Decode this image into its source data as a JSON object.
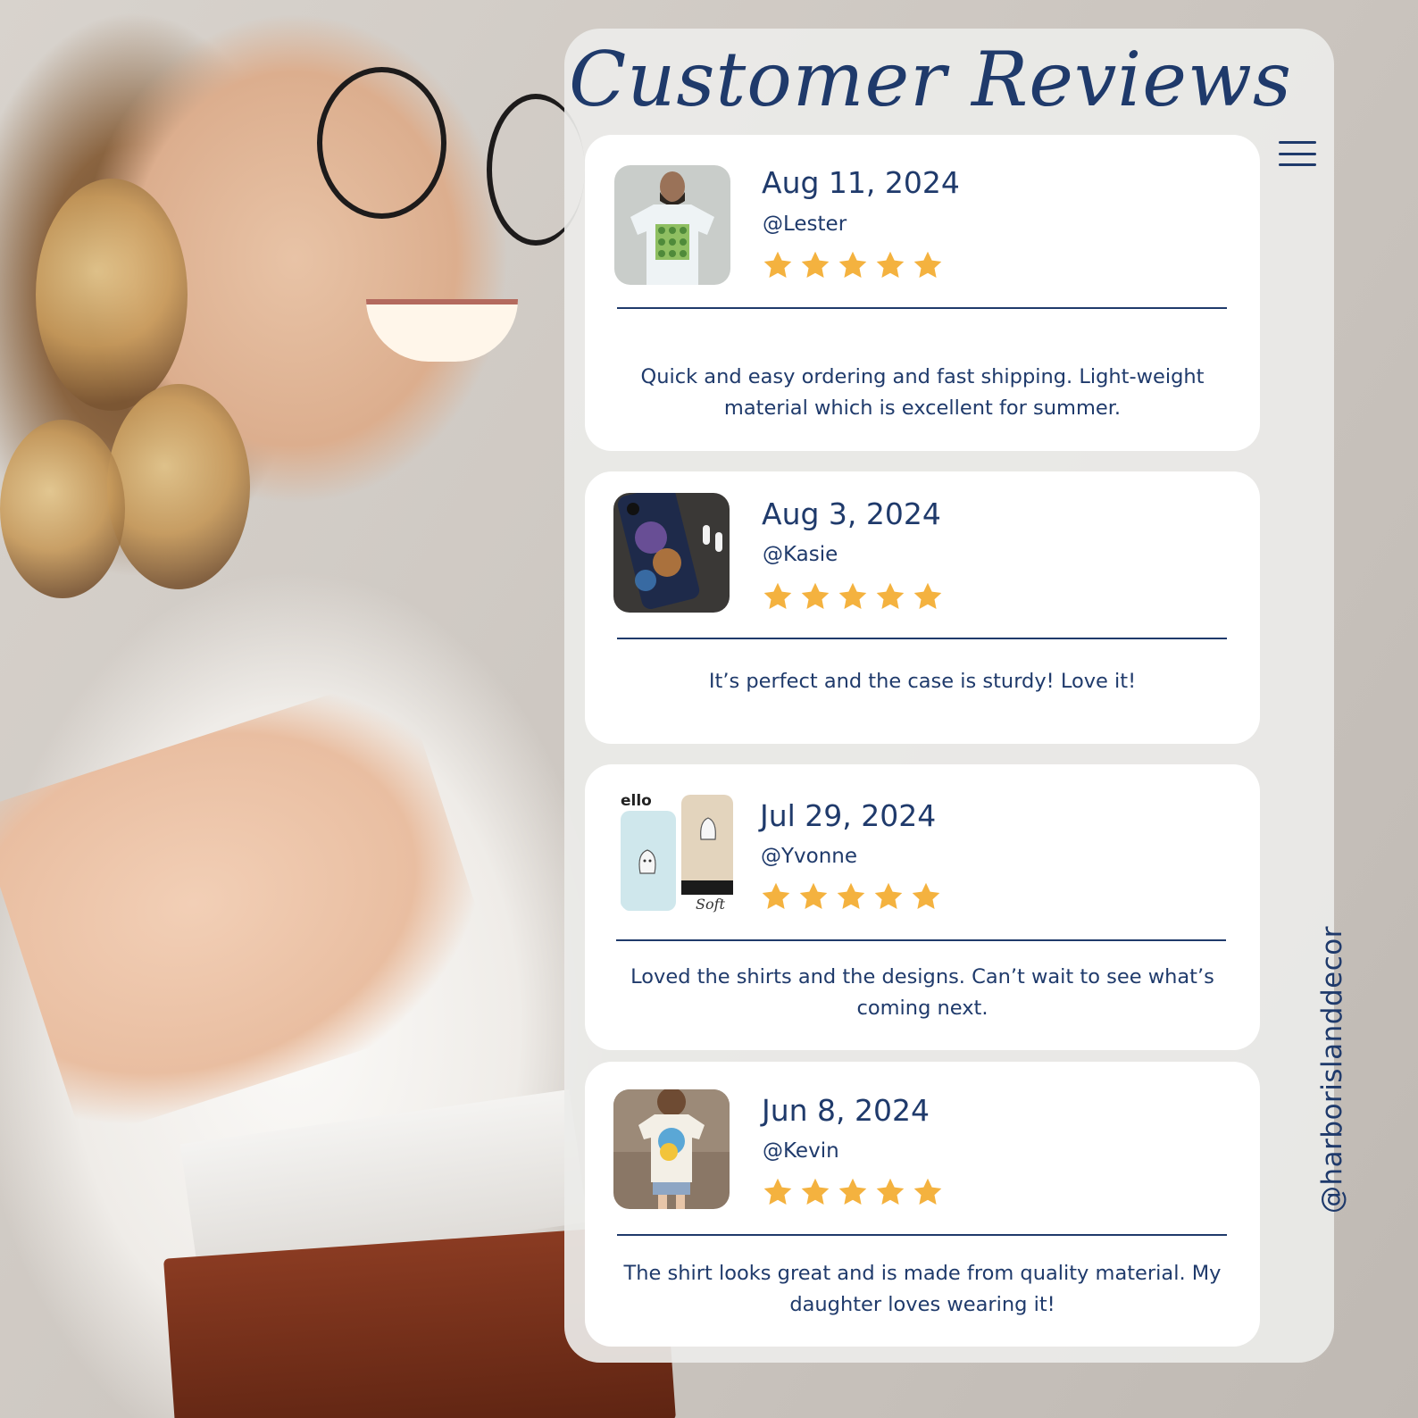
{
  "page": {
    "title": "Customer Reviews",
    "handle": "@harborislanddecor"
  },
  "colors": {
    "accent": "#1f3a6b",
    "star": "#f4b23f",
    "card": "#ffffff",
    "panel": "#ecebe9"
  },
  "icons": {
    "menu": "hamburger-menu-icon",
    "star": "star-icon"
  },
  "reviews": [
    {
      "date": "Aug 11, 2024",
      "user": "@Lester",
      "rating": 5,
      "text": "Quick and easy ordering and fast shipping. Light-weight material which is excellent for summer."
    },
    {
      "date": "Aug 3, 2024",
      "user": "@Kasie",
      "rating": 5,
      "text": "It’s perfect and the case is sturdy! Love it!"
    },
    {
      "date": "Jul 29, 2024",
      "user": "@Yvonne",
      "rating": 5,
      "text": "Loved the shirts and the designs. Can’t wait to see what’s coming next.",
      "photo_text": "ello"
    },
    {
      "date": "Jun 8, 2024",
      "user": "@Kevin",
      "rating": 5,
      "text": "The shirt looks great and is made from quality material. My daughter loves wearing it!"
    }
  ]
}
